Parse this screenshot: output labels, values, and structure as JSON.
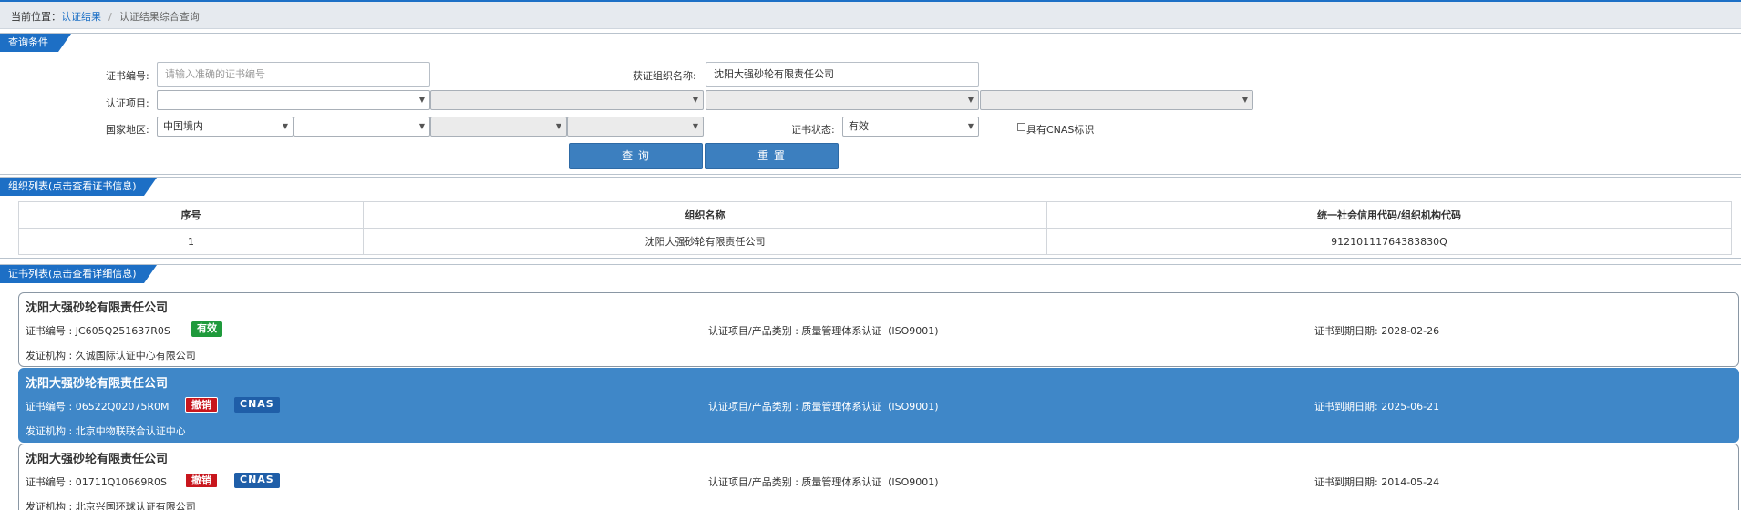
{
  "breadcrumb": {
    "prefix": "当前位置：",
    "link": "认证结果",
    "separator": "/",
    "current": "认证结果综合查询"
  },
  "query": {
    "tab_label": "查询条件",
    "cert_no_label": "证书编号:",
    "cert_no_placeholder": "请输入准确的证书编号",
    "org_name_label": "获证组织名称:",
    "org_name_value": "沈阳大强砂轮有限责任公司",
    "cert_item_label": "认证项目:",
    "region_label": "国家地区:",
    "region_value": "中国境内",
    "status_label": "证书状态:",
    "status_value": "有效",
    "cnas_checkbox_label": "具有CNAS标识",
    "search_button": "查 询",
    "reset_button": "重 置"
  },
  "org_list": {
    "tab_label": "组织列表(点击查看证书信息)",
    "columns": [
      "序号",
      "组织名称",
      "统一社会信用代码/组织机构代码"
    ],
    "rows": [
      [
        "1",
        "沈阳大强砂轮有限责任公司",
        "91210111764383830Q"
      ]
    ]
  },
  "cert_list": {
    "tab_label": "证书列表(点击查看详细信息)",
    "items": [
      {
        "title": "沈阳大强砂轮有限责任公司",
        "cert_no": "证书编号 : JC605Q251637R0S",
        "status_badge": "有效",
        "item": "认证项目/产品类别 : 质量管理体系认证（ISO9001)",
        "expiry": "证书到期日期: 2028-02-26",
        "issuer": "发证机构 : 久诚国际认证中心有限公司"
      },
      {
        "title": "沈阳大强砂轮有限责任公司",
        "cert_no": "证书编号 : 06522Q02075R0M",
        "status_badge": "撤销",
        "cnas_badge": "CNAS",
        "item": "认证项目/产品类别 : 质量管理体系认证（ISO9001)",
        "expiry": "证书到期日期: 2025-06-21",
        "issuer": "发证机构 : 北京中物联联合认证中心"
      },
      {
        "title": "沈阳大强砂轮有限责任公司",
        "cert_no": "证书编号 : 01711Q10669R0S",
        "status_badge": "撤销",
        "cnas_badge": "CNAS",
        "item": "认证项目/产品类别 : 质量管理体系认证（ISO9001)",
        "expiry": "证书到期日期: 2014-05-24",
        "issuer": "发证机构 : 北京兴国环球认证有限公司"
      }
    ]
  },
  "colors": {
    "accent": "#1d6fc5",
    "selected_card": "#3f87c8",
    "valid_badge": "#1f9a3c",
    "revoked_badge": "#c8161d",
    "cnas_badge": "#1f5ea8"
  }
}
